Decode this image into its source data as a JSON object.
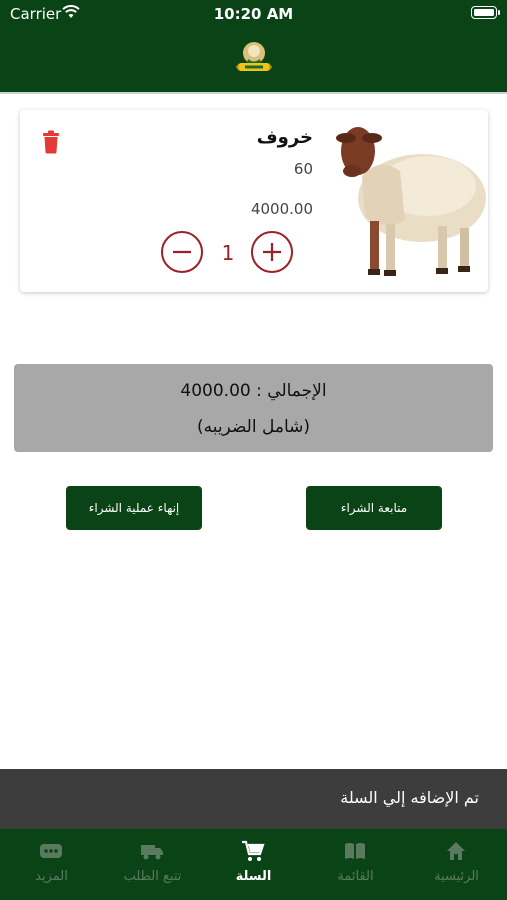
{
  "status_bar": {
    "carrier": "Carrier",
    "time": "10:20 AM"
  },
  "header": {
    "logo_icon": "app-logo"
  },
  "cart_item": {
    "name": "خروف",
    "weight": "60",
    "price": "4000.00",
    "quantity": "1",
    "image": "sheep-photo",
    "delete_icon": "trash-icon"
  },
  "summary": {
    "total_line": "الإجمالي : 4000.00",
    "tax_note": "(شامل الضريبه)"
  },
  "buttons": {
    "checkout": "إنهاء عملية الشراء",
    "continue": "متابعة الشراء"
  },
  "toast": {
    "message": "تم الإضافه إلي السلة"
  },
  "tabs": [
    {
      "label": "الرئيسية",
      "icon": "home-icon"
    },
    {
      "label": "القائمة",
      "icon": "menu-book-icon"
    },
    {
      "label": "السلة",
      "icon": "cart-icon",
      "active": true
    },
    {
      "label": "تتبع الطلب",
      "icon": "truck-icon"
    },
    {
      "label": "المزيد",
      "icon": "more-icon"
    }
  ],
  "colors": {
    "primary_green": "#0a4416",
    "accent_red": "#9c2027",
    "delete_red": "#e53935",
    "summary_gray": "#a8a8a8",
    "toast_gray": "#3d3d3d"
  }
}
